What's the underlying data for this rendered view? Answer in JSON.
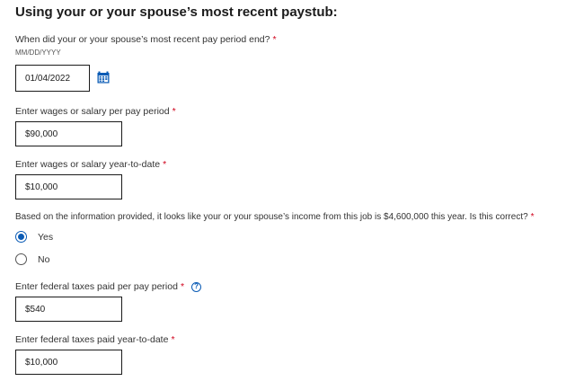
{
  "heading": "Using your or your spouse’s most recent paystub:",
  "required_marker": "*",
  "pay_period_end": {
    "label": "When did your or your spouse’s most recent pay period end?",
    "hint": "MM/DD/YYYY",
    "value": "01/04/2022",
    "icon": "calendar-icon"
  },
  "wages_per_period": {
    "label": "Enter wages or salary per pay period",
    "value": "$90,000"
  },
  "wages_ytd": {
    "label": "Enter wages or salary year-to-date",
    "value": "$10,000"
  },
  "income_confirm": {
    "question": "Based on the information provided, it looks like your or your spouse’s income from this job is $4,600,000 this year. Is this correct?",
    "options": [
      {
        "label": "Yes",
        "selected": true
      },
      {
        "label": "No",
        "selected": false
      }
    ]
  },
  "fed_tax_per_period": {
    "label": "Enter federal taxes paid per pay period",
    "value": "$540",
    "help_icon": "help-icon",
    "help_glyph": "?"
  },
  "fed_tax_ytd": {
    "label": "Enter federal taxes paid year-to-date",
    "value": "$10,000"
  },
  "colors": {
    "accent": "#0a5bb5",
    "required": "#d0021b",
    "border": "#1b1b1b"
  }
}
